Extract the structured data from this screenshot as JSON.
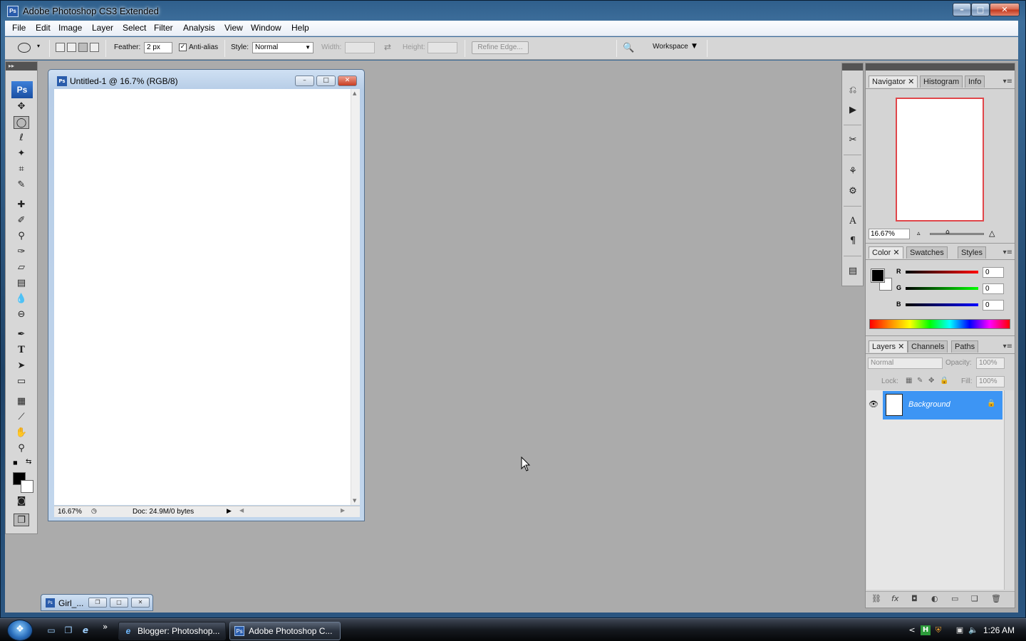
{
  "window": {
    "title": "Adobe Photoshop CS3 Extended",
    "icon": "Ps"
  },
  "menu": [
    "File",
    "Edit",
    "Image",
    "Layer",
    "Select",
    "Filter",
    "Analysis",
    "View",
    "Window",
    "Help"
  ],
  "options": {
    "feather_label": "Feather:",
    "feather_value": "2 px",
    "antialias_label": "Anti-alias",
    "antialias_checked": true,
    "style_label": "Style:",
    "style_value": "Normal",
    "width_label": "Width:",
    "height_label": "Height:",
    "refine_edge_label": "Refine Edge...",
    "workspace_label": "Workspace"
  },
  "toolbox": {
    "logo": "Ps",
    "tools": [
      "move-tool",
      "elliptical-marquee-tool",
      "lasso-tool",
      "magic-wand-tool",
      "crop-tool",
      "slice-tool",
      "spot-healing-tool",
      "brush-tool",
      "clone-stamp-tool",
      "history-brush-tool",
      "eraser-tool",
      "gradient-tool",
      "blur-tool",
      "dodge-tool",
      "pen-tool",
      "type-tool",
      "path-selection-tool",
      "rectangle-shape-tool",
      "notes-tool",
      "eyedropper-tool",
      "hand-tool",
      "zoom-tool"
    ],
    "active_tool": "elliptical-marquee-tool",
    "foreground_color": "#000000",
    "background_color": "#ffffff"
  },
  "document": {
    "title": "Untitled-1 @ 16.7% (RGB/8)",
    "zoom": "16.67%",
    "doc_info": "Doc: 24.9M/0 bytes"
  },
  "minimized_doc": {
    "label": "Girl_..."
  },
  "navigator": {
    "tabs": [
      "Navigator",
      "Histogram",
      "Info"
    ],
    "active_tab": "Navigator",
    "zoom": "16.67%"
  },
  "color_panel": {
    "tabs": [
      "Color",
      "Swatches",
      "Styles"
    ],
    "active_tab": "Color",
    "r_label": "R",
    "g_label": "G",
    "b_label": "B",
    "r_value": "0",
    "g_value": "0",
    "b_value": "0"
  },
  "layers_panel": {
    "tabs": [
      "Layers",
      "Channels",
      "Paths"
    ],
    "active_tab": "Layers",
    "blend_mode": "Normal",
    "opacity_label": "Opacity:",
    "opacity_value": "100%",
    "lock_label": "Lock:",
    "fill_label": "Fill:",
    "fill_value": "100%",
    "layer_name": "Background"
  },
  "taskbar": {
    "tasks": [
      {
        "label": "Blogger: Photoshop...",
        "icon": "ie-icon"
      },
      {
        "label": "Adobe Photoshop C...",
        "icon": "ps-icon",
        "active": true
      }
    ],
    "clock": "1:26 AM",
    "show_more": "»",
    "tray_expand": "<"
  },
  "colors": {
    "selected_layer": "#3d95f4",
    "navigator_view_box": "#e0464a",
    "workspace_bg": "#ababab"
  }
}
